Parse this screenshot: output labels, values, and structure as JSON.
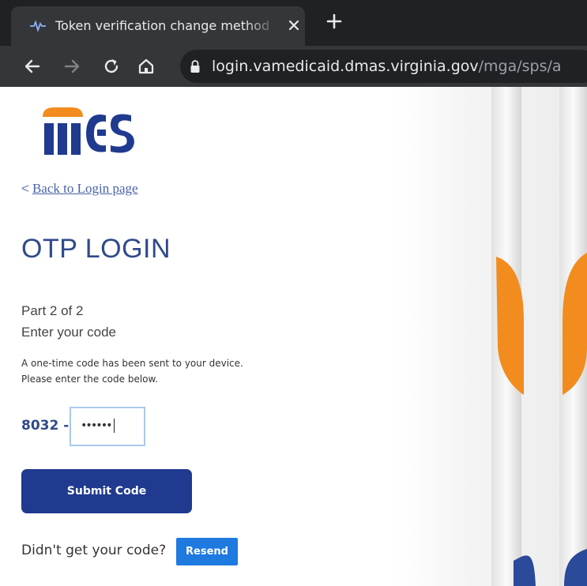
{
  "browser": {
    "tab_title": "Token verification change method",
    "url_host": "login.vamedicaid.dmas.virginia.gov",
    "url_path": "/mga/sps/a"
  },
  "logo": {
    "text": "MES"
  },
  "back_link": {
    "arrow": "<",
    "label": "Back to Login page"
  },
  "title": "OTP LOGIN",
  "step": "Part 2 of 2",
  "instruction": "Enter your code",
  "info_line1": "A one-time code has been sent to your device.",
  "info_line2": "Please enter the code below.",
  "code": {
    "prefix": "8032 -",
    "value": "••••••"
  },
  "submit_label": "Submit Code",
  "resend_prompt": "Didn't get your code?",
  "resend_label": "Resend",
  "colors": {
    "brand_blue": "#1f3a8f",
    "brand_orange": "#f28c1e",
    "resend_blue": "#1f7ae0",
    "link": "#4a62a8"
  }
}
